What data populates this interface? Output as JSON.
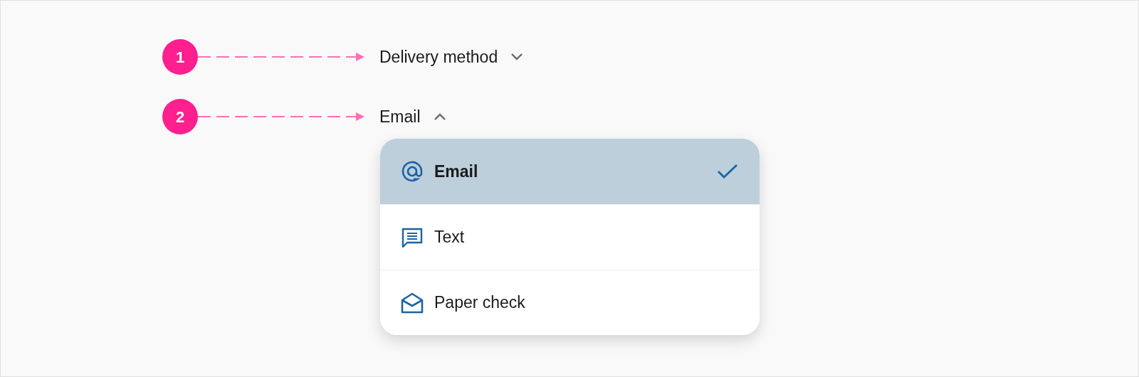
{
  "callouts": [
    {
      "marker": "1",
      "label": "Delivery method",
      "expanded": false
    },
    {
      "marker": "2",
      "label": "Email",
      "expanded": true
    }
  ],
  "menu": {
    "items": [
      {
        "label": "Email",
        "selected": true
      },
      {
        "label": "Text",
        "selected": false
      },
      {
        "label": "Paper check",
        "selected": false
      }
    ]
  }
}
